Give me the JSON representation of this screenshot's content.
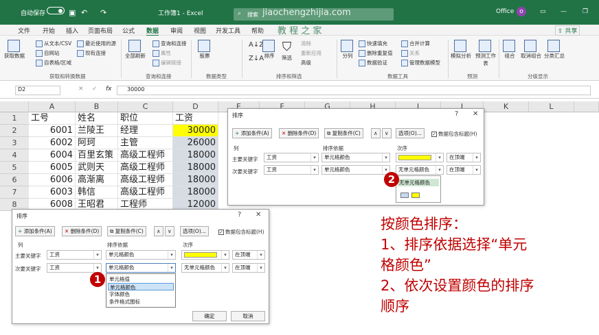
{
  "titlebar": {
    "autosave": "自动保存",
    "toggle": "关",
    "title": "工作簿1 - Excel",
    "search": "搜索",
    "watermark": "jiaochengzhijia.com",
    "watermark_cn": "教 程 之 家",
    "office": "Office",
    "user_initial": "o",
    "app_color": "#217346"
  },
  "menu": [
    "文件",
    "开始",
    "插入",
    "页面布局",
    "公式",
    "数据",
    "审阅",
    "视图",
    "开发工具",
    "帮助"
  ],
  "menu_active": "数据",
  "share": "共享",
  "ribbon": {
    "get_data": "获取数据",
    "from_text": "从文本/CSV",
    "from_web": "自网站",
    "from_table": "自表格/区域",
    "recent": "最近使用的源",
    "existing": "现有连接",
    "group1": "获取和转换数据",
    "refresh_all": "全部刷新",
    "queries": "查询和连接",
    "properties": "属性",
    "edit_links": "编辑链接",
    "group2": "查询和连接",
    "stocks": "股票",
    "group3": "数据类型",
    "sort": "排序",
    "filter": "筛选",
    "clear": "清除",
    "reapply": "重新应用",
    "advanced": "高级",
    "group4": "排序和筛选",
    "split": "分列",
    "flash": "快速填充",
    "remove_dup": "删除重复值",
    "validation": "数据验证",
    "consolidate": "合并计算",
    "relations": "关系",
    "manage_model": "管理数据模型",
    "group5": "数据工具",
    "whatif": "模拟分析",
    "forecast": "预测工作表",
    "group6": "预测",
    "group_btn": "组合",
    "ungroup": "取消组合",
    "subtotal": "分类汇总",
    "group7": "分级显示"
  },
  "formula": {
    "namebox": "D2",
    "value": "30000"
  },
  "sheet": {
    "columns": [
      "A",
      "B",
      "C",
      "D",
      "E",
      "F",
      "G",
      "H",
      "I",
      "J",
      "K",
      "L"
    ],
    "rows": [
      {
        "n": "1",
        "a": "工号",
        "b": "姓名",
        "c": "职位",
        "d": "工资",
        "num": false
      },
      {
        "n": "2",
        "a": "6001",
        "b": "兰陵王",
        "c": "经理",
        "d": "30000",
        "num": true
      },
      {
        "n": "3",
        "a": "6002",
        "b": "阿珂",
        "c": "主管",
        "d": "26000",
        "num": true
      },
      {
        "n": "4",
        "a": "6004",
        "b": "百里玄策",
        "c": "高级工程师",
        "d": "18000",
        "num": true
      },
      {
        "n": "5",
        "a": "6005",
        "b": "武则天",
        "c": "高级工程师",
        "d": "18000",
        "num": true
      },
      {
        "n": "6",
        "a": "6006",
        "b": "高渐离",
        "c": "高级工程师",
        "d": "18000",
        "num": true
      },
      {
        "n": "7",
        "a": "6003",
        "b": "韩信",
        "c": "高级工程师",
        "d": "18000",
        "num": true
      },
      {
        "n": "8",
        "a": "6008",
        "b": "王昭君",
        "c": "工程师",
        "d": "12000",
        "num": true
      }
    ]
  },
  "dialog": {
    "title": "排序",
    "help": "?",
    "close": "✕",
    "add": "添加条件(A)",
    "delete": "删除条件(D)",
    "copy": "复制条件(C)",
    "up": "∧",
    "down": "∨",
    "options": "选项(O)...",
    "header": "数据包含标题(H)",
    "col_label": "列",
    "basis_label": "排序依据",
    "order_label": "次序",
    "primary": "主要关键字",
    "secondary": "次要关键字",
    "key_value": "工资",
    "basis_value": "单元格颜色",
    "no_color": "无单元格颜色",
    "position": "在顶端",
    "ok": "确定",
    "cancel": "取消",
    "basis_options": [
      "单元格值",
      "单元格颜色",
      "字体颜色",
      "条件格式图标"
    ],
    "color_options": [
      "无单元格颜色"
    ],
    "color_yellow": "#ffff00",
    "color_blue": "#c5d9f1"
  },
  "badges": {
    "one": "1",
    "two": "2"
  },
  "note": [
    "按颜色排序：",
    "1、排序依据选择“单元",
    "格颜色”",
    "2、依次设置颜色的排序",
    "顺序"
  ]
}
